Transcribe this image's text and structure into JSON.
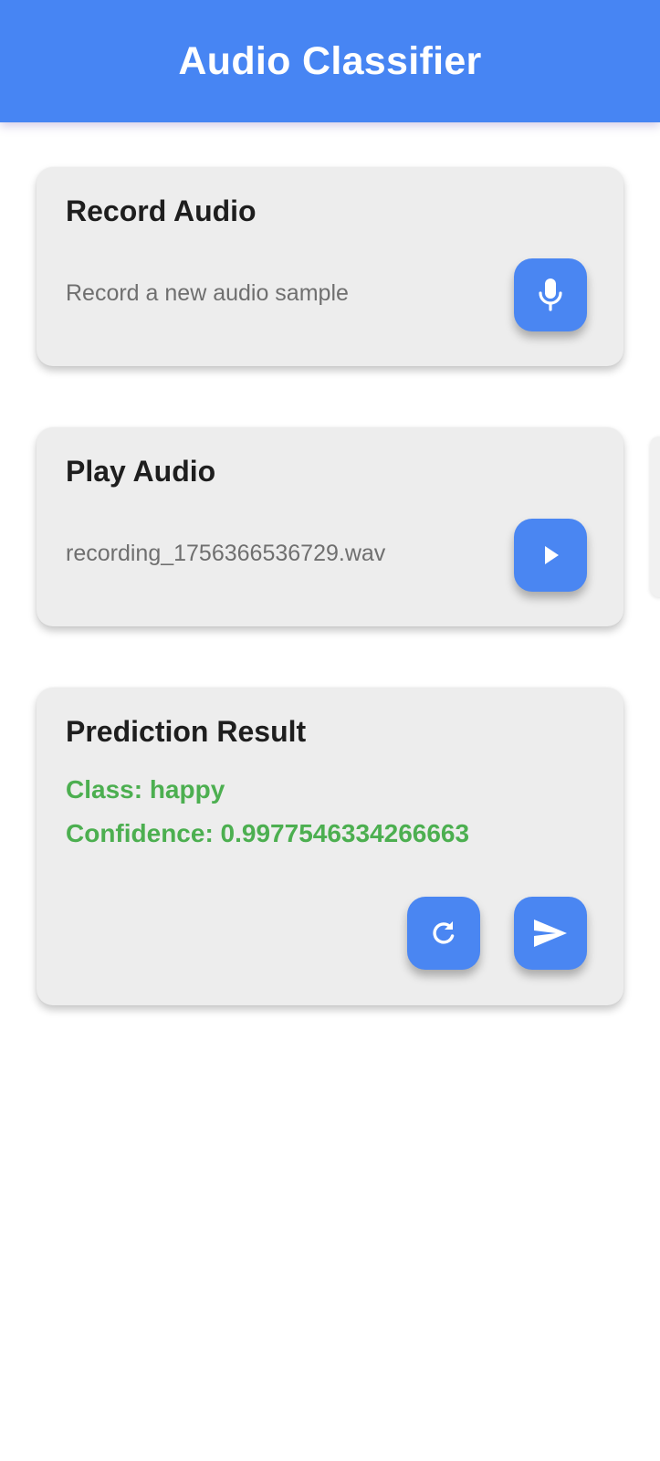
{
  "app_bar": {
    "title": "Audio Classifier",
    "color": "#4785f3"
  },
  "record_card": {
    "title": "Record Audio",
    "subtitle": "Record a new audio sample",
    "button_icon": "microphone-icon"
  },
  "play_card": {
    "title": "Play Audio",
    "filename": "recording_1756366536729.wav",
    "button_icon": "play-icon"
  },
  "prediction_card": {
    "title": "Prediction Result",
    "class_line": "Class: happy",
    "confidence_line": "Confidence: 0.9977546334266663",
    "result_color": "#4caf50",
    "refresh_icon": "refresh-icon",
    "send_icon": "send-icon"
  },
  "colors": {
    "button": "#4a86f2",
    "card": "#ededed",
    "title_text": "#1e1e1e",
    "subtitle_text": "#6f6f6f"
  }
}
